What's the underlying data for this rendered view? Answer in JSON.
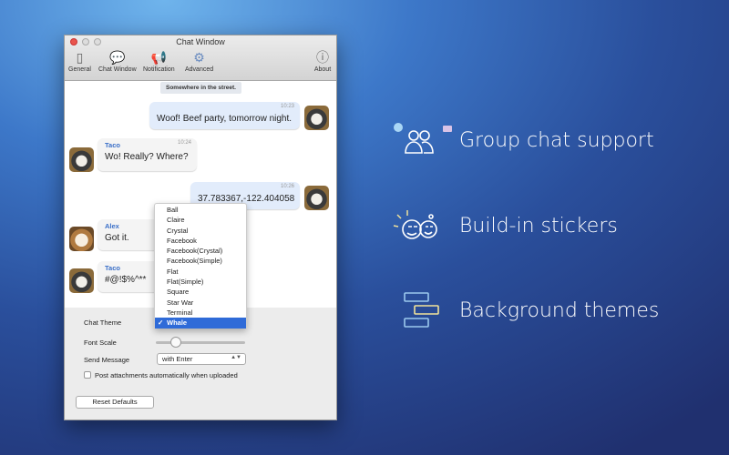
{
  "window": {
    "title": "Chat Window"
  },
  "toolbar": [
    {
      "label": "General",
      "icon": "switch-icon"
    },
    {
      "label": "Chat Window",
      "icon": "chat-bubble-icon"
    },
    {
      "label": "Notification",
      "icon": "megaphone-icon"
    },
    {
      "label": "Advanced",
      "icon": "gear-icon"
    },
    {
      "label": "About",
      "icon": "info-icon"
    }
  ],
  "chat": {
    "note": "Somewhere in the street.",
    "messages": [
      {
        "sender": "",
        "time": "10:23",
        "text": "Woof! Beef party, tomorrow night."
      },
      {
        "sender": "Taco",
        "time": "10:24",
        "text": "Wo! Really? Where?"
      },
      {
        "sender": "",
        "time": "10:26",
        "text": "37.783367,-122.404058"
      },
      {
        "sender": "Alex",
        "time": "",
        "text": "Got it."
      },
      {
        "sender": "Taco",
        "time": "",
        "text": "#@!$%^**"
      }
    ]
  },
  "theme_menu": {
    "options": [
      "Ball",
      "Claire",
      "Crystal",
      "Facebook",
      "Facebook(Crystal)",
      "Facebook(Simple)",
      "Flat",
      "Flat(Simple)",
      "Square",
      "Star War",
      "Terminal",
      "Whale"
    ],
    "selected": "Whale",
    "check": "✓"
  },
  "settings": {
    "chat_theme_label": "Chat Theme",
    "font_scale_label": "Font Scale",
    "font_scale_value": 0.22,
    "send_message_label": "Send Message",
    "send_message_value": "with Enter",
    "post_attachments_label": "Post attachments automatically when uploaded",
    "post_attachments_checked": false,
    "reset_label": "Reset Defaults"
  },
  "features": [
    "Group chat support",
    "Build-in stickers",
    "Background themes"
  ]
}
